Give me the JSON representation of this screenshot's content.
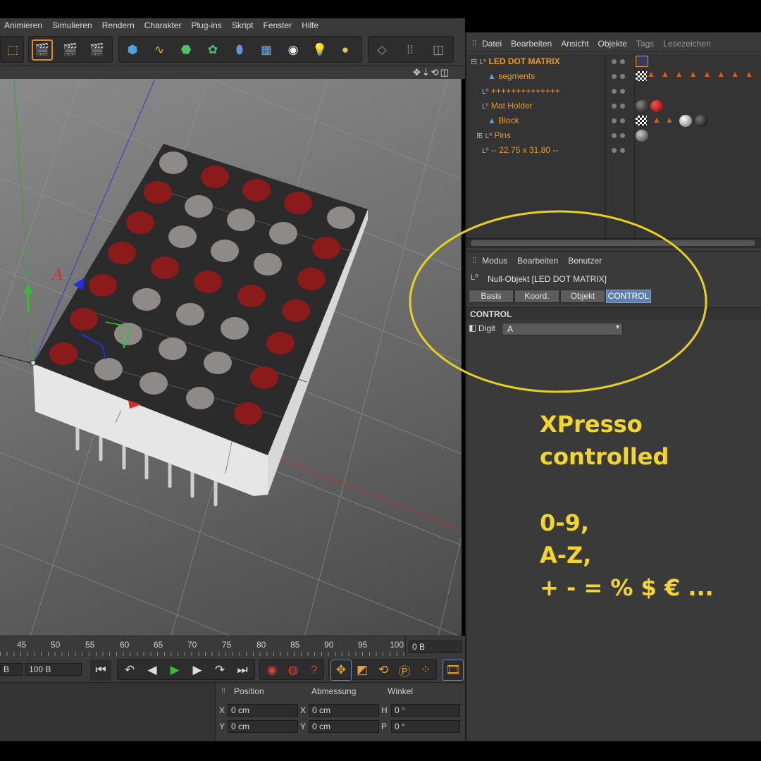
{
  "menubar": [
    "Animieren",
    "Simulieren",
    "Rendern",
    "Charakter",
    "Plug-ins",
    "Skript",
    "Fenster",
    "Hilfe"
  ],
  "object_manager": {
    "menu": [
      "Datei",
      "Bearbeiten",
      "Ansicht",
      "Objekte",
      "Tags",
      "Lesezeichen"
    ],
    "rows": [
      {
        "name": "LED DOT MATRIX"
      },
      {
        "name": "segments"
      },
      {
        "name": "++++++++++++++"
      },
      {
        "name": "Mat Holder"
      },
      {
        "name": "Block"
      },
      {
        "name": "Pins"
      },
      {
        "name": "--  22.75  x  31.80  --"
      }
    ]
  },
  "attribute_manager": {
    "menu": [
      "Modus",
      "Bearbeiten",
      "Benutzer"
    ],
    "object_title": "Null-Objekt [LED DOT MATRIX]",
    "tabs": [
      "Basis",
      "Koord.",
      "Objekt",
      "CONTROL"
    ],
    "active_tab": "CONTROL",
    "section": "CONTROL",
    "digit_label": "Digit",
    "digit_value": "A"
  },
  "annotation": {
    "line1": "XPresso",
    "line2": "controlled",
    "line3": "0-9,",
    "line4": "A-Z,",
    "line5": "+ - = % $ € ...",
    "color": "#f4d52a"
  },
  "viewport": {
    "axis_label": "A"
  },
  "timeline": {
    "ticks": [
      "45",
      "50",
      "55",
      "60",
      "65",
      "70",
      "75",
      "80",
      "85",
      "90",
      "95",
      "100"
    ],
    "current_frame": "0 B",
    "left_field": "B",
    "end_field": "100 B"
  },
  "coordinates": {
    "headers": [
      "Position",
      "Abmessung",
      "Winkel"
    ],
    "rows": [
      {
        "pos_label": "X",
        "pos": "0 cm",
        "size_label": "X",
        "size": "0 cm",
        "rot_label": "H",
        "rot": "0 °"
      },
      {
        "pos_label": "Y",
        "pos": "0 cm",
        "size_label": "Y",
        "size": "0 cm",
        "rot_label": "P",
        "rot": "0 °"
      }
    ]
  },
  "colors": {
    "led_on": "#8b1a1a",
    "led_off": "#8f8a8a",
    "selection_orange": "#e89a2c",
    "highlight_circle": "#e6d21e"
  }
}
